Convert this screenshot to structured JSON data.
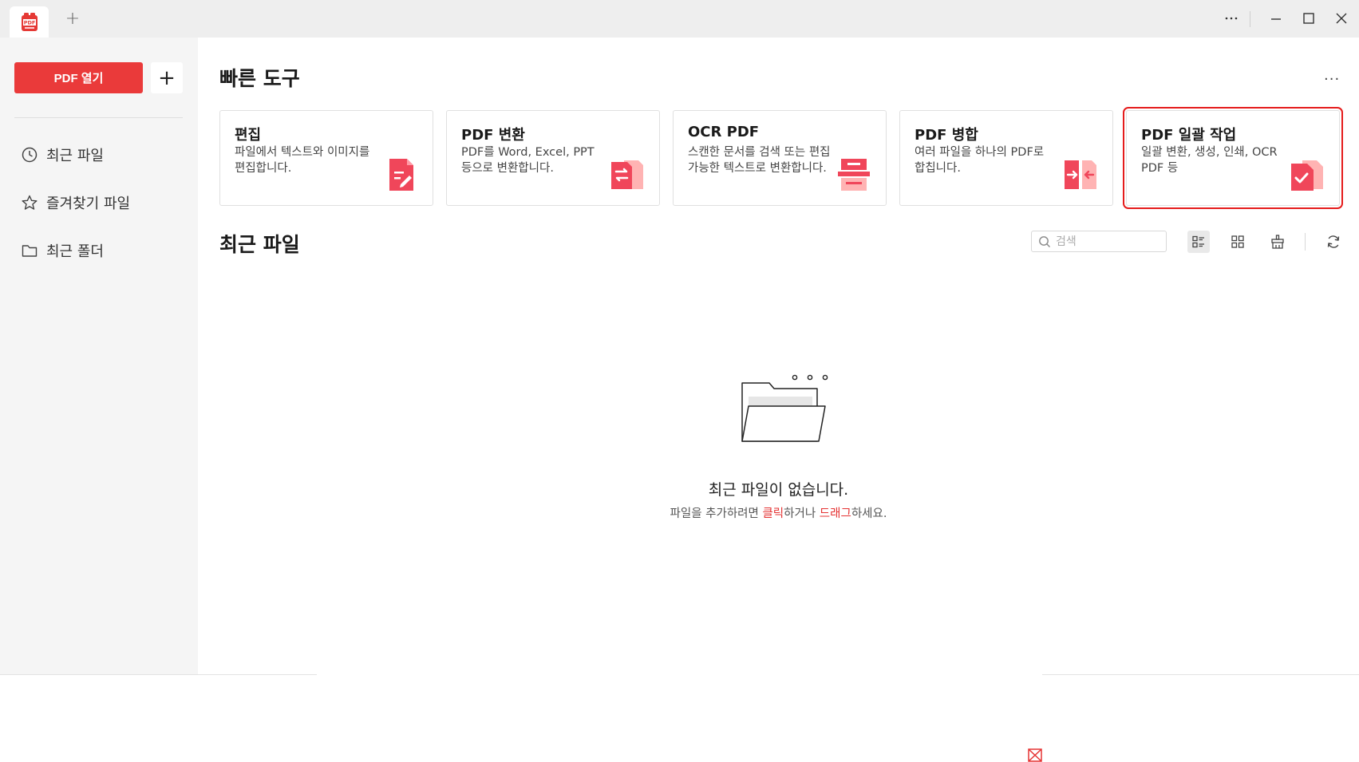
{
  "titlebar": {
    "logo_text": "PDF",
    "new_tab_label": "+",
    "more_label": "···"
  },
  "sidebar": {
    "open_button_label": "PDF 열기",
    "add_button_label": "+",
    "items": [
      {
        "label": "최근 파일",
        "icon": "clock-icon"
      },
      {
        "label": "즐겨찾기 파일",
        "icon": "star-icon"
      },
      {
        "label": "최근 폴더",
        "icon": "folder-icon"
      }
    ]
  },
  "quick_tools": {
    "title": "빠른 도구",
    "more_label": "···",
    "cards": [
      {
        "title": "편집",
        "desc": "파일에서 텍스트와 이미지를 편집합니다.",
        "icon": "edit-doc-icon"
      },
      {
        "title": "PDF 변환",
        "desc": "PDF를 Word, Excel, PPT 등으로 변환합니다.",
        "icon": "convert-doc-icon"
      },
      {
        "title": "OCR PDF",
        "desc": "스캔한 문서를 검색 또는 편집 가능한 텍스트로 변환합니다.",
        "icon": "ocr-scan-icon"
      },
      {
        "title": "PDF 병합",
        "desc": "여러 파일을 하나의 PDF로 합칩니다.",
        "icon": "merge-doc-icon"
      },
      {
        "title": "PDF 일괄 작업",
        "desc": "일괄 변환, 생성, 인쇄, OCR PDF 등",
        "icon": "batch-check-icon"
      }
    ]
  },
  "recent": {
    "title": "최근 파일",
    "search_placeholder": "검색",
    "empty_title": "최근 파일이 없습니다.",
    "empty_sub_prefix": "파일을 추가하려면 ",
    "empty_sub_click": "클릭",
    "empty_sub_mid": "하거나 ",
    "empty_sub_drag": "드래그",
    "empty_sub_suffix": "하세요."
  },
  "colors": {
    "accent": "#ea3a3a",
    "link": "#e53333",
    "sidebar_bg": "#f5f5f5",
    "selected_border": "#e51c1c"
  }
}
